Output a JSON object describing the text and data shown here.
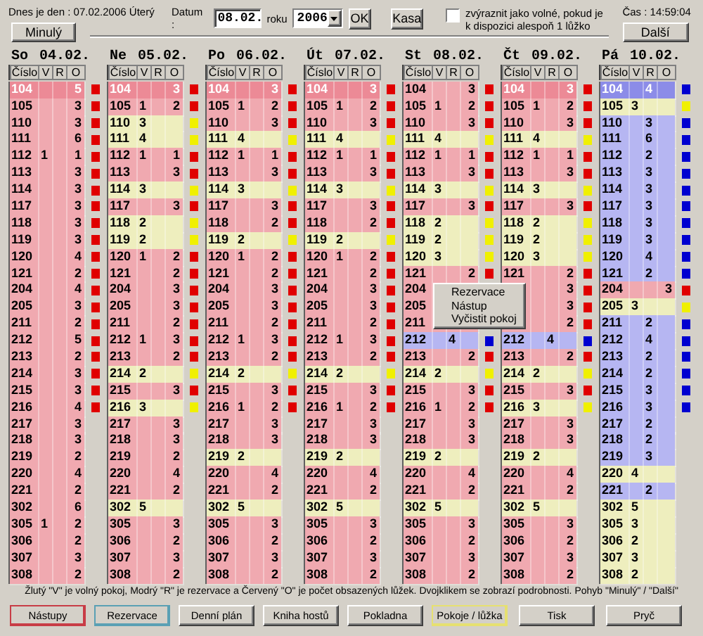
{
  "header": {
    "today": "Dnes je den : 07.02.2006  Úterý",
    "date_label": "Datum :",
    "date_value": "08.02.",
    "year_label": "roku",
    "year_value": "2006",
    "ok_button": "OK",
    "cash_button": "Kasa",
    "highlight_checkbox": {
      "label": "zvýraznit jako volné, pokud je k dispozici alespoň 1 lůžko",
      "checked": false
    },
    "time": "Čas : 14:59:04",
    "prev_button": "Minulý",
    "next_button": "Další"
  },
  "columns": [
    {
      "day": "So",
      "date": "04.02.",
      "headers": [
        "Číslo",
        "V",
        "R",
        "O"
      ],
      "rows": [
        {
          "room": "104",
          "o": "5",
          "kind": "occupied",
          "selected": true,
          "marker": true
        },
        {
          "room": "105",
          "o": "3",
          "kind": "occupied",
          "selected": false,
          "marker": true
        },
        {
          "room": "110",
          "o": "3",
          "kind": "occupied",
          "selected": false,
          "marker": true
        },
        {
          "room": "111",
          "o": "6",
          "kind": "occupied",
          "selected": false,
          "marker": true
        },
        {
          "room": "112",
          "v": "1",
          "o": "1",
          "kind": "occupied",
          "selected": false,
          "marker": true
        },
        {
          "room": "113",
          "o": "3",
          "kind": "occupied",
          "selected": false,
          "marker": true
        },
        {
          "room": "114",
          "o": "3",
          "kind": "occupied",
          "selected": false,
          "marker": true
        },
        {
          "room": "117",
          "o": "3",
          "kind": "occupied",
          "selected": false,
          "marker": true
        },
        {
          "room": "118",
          "o": "3",
          "kind": "occupied",
          "selected": false,
          "marker": true
        },
        {
          "room": "119",
          "o": "3",
          "kind": "occupied",
          "selected": false,
          "marker": true
        },
        {
          "room": "120",
          "o": "4",
          "kind": "occupied",
          "selected": false,
          "marker": true
        },
        {
          "room": "121",
          "o": "2",
          "kind": "occupied",
          "selected": false,
          "marker": true
        },
        {
          "room": "204",
          "o": "4",
          "kind": "occupied",
          "selected": false,
          "marker": true
        },
        {
          "room": "205",
          "o": "3",
          "kind": "occupied",
          "selected": false,
          "marker": true
        },
        {
          "room": "211",
          "o": "2",
          "kind": "occupied",
          "selected": false,
          "marker": true
        },
        {
          "room": "212",
          "o": "5",
          "kind": "occupied",
          "selected": false,
          "marker": true
        },
        {
          "room": "213",
          "o": "2",
          "kind": "occupied",
          "selected": false,
          "marker": true
        },
        {
          "room": "214",
          "o": "3",
          "kind": "occupied",
          "selected": false,
          "marker": true
        },
        {
          "room": "215",
          "o": "3",
          "kind": "occupied",
          "selected": false,
          "marker": true
        },
        {
          "room": "216",
          "o": "4",
          "kind": "occupied",
          "selected": false,
          "marker": true
        },
        {
          "room": "217",
          "o": "3",
          "kind": "occupied",
          "selected": false,
          "marker": false
        },
        {
          "room": "218",
          "o": "3",
          "kind": "occupied",
          "selected": false,
          "marker": false
        },
        {
          "room": "219",
          "o": "2",
          "kind": "occupied",
          "selected": false,
          "marker": false
        },
        {
          "room": "220",
          "o": "4",
          "kind": "occupied",
          "selected": false,
          "marker": false
        },
        {
          "room": "221",
          "o": "2",
          "kind": "occupied",
          "selected": false,
          "marker": false
        },
        {
          "room": "302",
          "o": "6",
          "kind": "occupied",
          "selected": false,
          "marker": false
        },
        {
          "room": "305",
          "v": "1",
          "o": "2",
          "kind": "occupied",
          "selected": false,
          "marker": false
        },
        {
          "room": "306",
          "o": "2",
          "kind": "occupied",
          "selected": false,
          "marker": false
        },
        {
          "room": "307",
          "o": "3",
          "kind": "occupied",
          "selected": false,
          "marker": false
        },
        {
          "room": "308",
          "o": "2",
          "kind": "occupied",
          "selected": false,
          "marker": false
        }
      ]
    },
    {
      "day": "Ne",
      "date": "05.02.",
      "headers": [
        "Číslo",
        "V",
        "R",
        "O"
      ],
      "rows": [
        {
          "room": "104",
          "o": "3",
          "kind": "occupied",
          "selected": true,
          "marker": true
        },
        {
          "room": "105",
          "v": "1",
          "o": "2",
          "kind": "occupied",
          "selected": false,
          "marker": true
        },
        {
          "room": "110",
          "v": "3",
          "kind": "free",
          "selected": false,
          "marker": true
        },
        {
          "room": "111",
          "v": "4",
          "kind": "free",
          "selected": false,
          "marker": true
        },
        {
          "room": "112",
          "v": "1",
          "o": "1",
          "kind": "occupied",
          "selected": false,
          "marker": true
        },
        {
          "room": "113",
          "o": "3",
          "kind": "occupied",
          "selected": false,
          "marker": true
        },
        {
          "room": "114",
          "v": "3",
          "kind": "free",
          "selected": false,
          "marker": true
        },
        {
          "room": "117",
          "o": "3",
          "kind": "occupied",
          "selected": false,
          "marker": true
        },
        {
          "room": "118",
          "v": "2",
          "kind": "free",
          "selected": false,
          "marker": true
        },
        {
          "room": "119",
          "v": "2",
          "kind": "free",
          "selected": false,
          "marker": true
        },
        {
          "room": "120",
          "v": "1",
          "o": "2",
          "kind": "occupied",
          "selected": false,
          "marker": true
        },
        {
          "room": "121",
          "o": "2",
          "kind": "occupied",
          "selected": false,
          "marker": true
        },
        {
          "room": "204",
          "o": "3",
          "kind": "occupied",
          "selected": false,
          "marker": true
        },
        {
          "room": "205",
          "o": "3",
          "kind": "occupied",
          "selected": false,
          "marker": true
        },
        {
          "room": "211",
          "o": "2",
          "kind": "occupied",
          "selected": false,
          "marker": true
        },
        {
          "room": "212",
          "v": "1",
          "o": "3",
          "kind": "occupied",
          "selected": false,
          "marker": true
        },
        {
          "room": "213",
          "o": "2",
          "kind": "occupied",
          "selected": false,
          "marker": true
        },
        {
          "room": "214",
          "v": "2",
          "kind": "free",
          "selected": false,
          "marker": true
        },
        {
          "room": "215",
          "o": "3",
          "kind": "occupied",
          "selected": false,
          "marker": true
        },
        {
          "room": "216",
          "v": "3",
          "kind": "free",
          "selected": false,
          "marker": true
        },
        {
          "room": "217",
          "o": "3",
          "kind": "occupied",
          "selected": false,
          "marker": false
        },
        {
          "room": "218",
          "o": "3",
          "kind": "occupied",
          "selected": false,
          "marker": false
        },
        {
          "room": "219",
          "o": "2",
          "kind": "occupied",
          "selected": false,
          "marker": false
        },
        {
          "room": "220",
          "o": "4",
          "kind": "occupied",
          "selected": false,
          "marker": false
        },
        {
          "room": "221",
          "o": "2",
          "kind": "occupied",
          "selected": false,
          "marker": false
        },
        {
          "room": "302",
          "v": "5",
          "kind": "free",
          "selected": false,
          "marker": false
        },
        {
          "room": "305",
          "o": "3",
          "kind": "occupied",
          "selected": false,
          "marker": false
        },
        {
          "room": "306",
          "o": "2",
          "kind": "occupied",
          "selected": false,
          "marker": false
        },
        {
          "room": "307",
          "o": "3",
          "kind": "occupied",
          "selected": false,
          "marker": false
        },
        {
          "room": "308",
          "o": "2",
          "kind": "occupied",
          "selected": false,
          "marker": false
        }
      ]
    },
    {
      "day": "Po",
      "date": "06.02.",
      "headers": [
        "Číslo",
        "V",
        "R",
        "O"
      ],
      "rows": [
        {
          "room": "104",
          "o": "3",
          "kind": "occupied",
          "selected": true,
          "marker": true
        },
        {
          "room": "105",
          "v": "1",
          "o": "2",
          "kind": "occupied",
          "selected": false,
          "marker": true
        },
        {
          "room": "110",
          "o": "3",
          "kind": "occupied",
          "selected": false,
          "marker": true
        },
        {
          "room": "111",
          "v": "4",
          "kind": "free",
          "selected": false,
          "marker": true
        },
        {
          "room": "112",
          "v": "1",
          "o": "1",
          "kind": "occupied",
          "selected": false,
          "marker": true
        },
        {
          "room": "113",
          "o": "3",
          "kind": "occupied",
          "selected": false,
          "marker": true
        },
        {
          "room": "114",
          "v": "3",
          "kind": "free",
          "selected": false,
          "marker": true
        },
        {
          "room": "117",
          "o": "3",
          "kind": "occupied",
          "selected": false,
          "marker": true
        },
        {
          "room": "118",
          "o": "2",
          "kind": "occupied",
          "selected": false,
          "marker": true
        },
        {
          "room": "119",
          "v": "2",
          "kind": "free",
          "selected": false,
          "marker": true
        },
        {
          "room": "120",
          "v": "1",
          "o": "2",
          "kind": "occupied",
          "selected": false,
          "marker": true
        },
        {
          "room": "121",
          "o": "2",
          "kind": "occupied",
          "selected": false,
          "marker": true
        },
        {
          "room": "204",
          "o": "3",
          "kind": "occupied",
          "selected": false,
          "marker": true
        },
        {
          "room": "205",
          "o": "3",
          "kind": "occupied",
          "selected": false,
          "marker": true
        },
        {
          "room": "211",
          "o": "2",
          "kind": "occupied",
          "selected": false,
          "marker": true
        },
        {
          "room": "212",
          "v": "1",
          "o": "3",
          "kind": "occupied",
          "selected": false,
          "marker": true
        },
        {
          "room": "213",
          "o": "2",
          "kind": "occupied",
          "selected": false,
          "marker": true
        },
        {
          "room": "214",
          "v": "2",
          "kind": "free",
          "selected": false,
          "marker": true
        },
        {
          "room": "215",
          "o": "3",
          "kind": "occupied",
          "selected": false,
          "marker": true
        },
        {
          "room": "216",
          "v": "1",
          "o": "2",
          "kind": "occupied",
          "selected": false,
          "marker": true
        },
        {
          "room": "217",
          "o": "3",
          "kind": "occupied",
          "selected": false,
          "marker": false
        },
        {
          "room": "218",
          "o": "3",
          "kind": "occupied",
          "selected": false,
          "marker": false
        },
        {
          "room": "219",
          "v": "2",
          "kind": "free",
          "selected": false,
          "marker": false
        },
        {
          "room": "220",
          "o": "4",
          "kind": "occupied",
          "selected": false,
          "marker": false
        },
        {
          "room": "221",
          "o": "2",
          "kind": "occupied",
          "selected": false,
          "marker": false
        },
        {
          "room": "302",
          "v": "5",
          "kind": "free",
          "selected": false,
          "marker": false
        },
        {
          "room": "305",
          "o": "3",
          "kind": "occupied",
          "selected": false,
          "marker": false
        },
        {
          "room": "306",
          "o": "2",
          "kind": "occupied",
          "selected": false,
          "marker": false
        },
        {
          "room": "307",
          "o": "3",
          "kind": "occupied",
          "selected": false,
          "marker": false
        },
        {
          "room": "308",
          "o": "2",
          "kind": "occupied",
          "selected": false,
          "marker": false
        }
      ]
    },
    {
      "day": "Út",
      "date": "07.02.",
      "headers": [
        "Číslo",
        "V",
        "R",
        "O"
      ],
      "rows": [
        {
          "room": "104",
          "o": "3",
          "kind": "occupied",
          "selected": true,
          "marker": true
        },
        {
          "room": "105",
          "v": "1",
          "o": "2",
          "kind": "occupied",
          "selected": false,
          "marker": true
        },
        {
          "room": "110",
          "o": "3",
          "kind": "occupied",
          "selected": false,
          "marker": true
        },
        {
          "room": "111",
          "v": "4",
          "kind": "free",
          "selected": false,
          "marker": true
        },
        {
          "room": "112",
          "v": "1",
          "o": "1",
          "kind": "occupied",
          "selected": false,
          "marker": true
        },
        {
          "room": "113",
          "o": "3",
          "kind": "occupied",
          "selected": false,
          "marker": true
        },
        {
          "room": "114",
          "v": "3",
          "kind": "free",
          "selected": false,
          "marker": true
        },
        {
          "room": "117",
          "o": "3",
          "kind": "occupied",
          "selected": false,
          "marker": true
        },
        {
          "room": "118",
          "o": "2",
          "kind": "occupied",
          "selected": false,
          "marker": true
        },
        {
          "room": "119",
          "v": "2",
          "kind": "free",
          "selected": false,
          "marker": true
        },
        {
          "room": "120",
          "v": "1",
          "o": "2",
          "kind": "occupied",
          "selected": false,
          "marker": true
        },
        {
          "room": "121",
          "o": "2",
          "kind": "occupied",
          "selected": false,
          "marker": true
        },
        {
          "room": "204",
          "o": "3",
          "kind": "occupied",
          "selected": false,
          "marker": true
        },
        {
          "room": "205",
          "o": "3",
          "kind": "occupied",
          "selected": false,
          "marker": true
        },
        {
          "room": "211",
          "o": "2",
          "kind": "occupied",
          "selected": false,
          "marker": true
        },
        {
          "room": "212",
          "v": "1",
          "o": "3",
          "kind": "occupied",
          "selected": false,
          "marker": true
        },
        {
          "room": "213",
          "o": "2",
          "kind": "occupied",
          "selected": false,
          "marker": true
        },
        {
          "room": "214",
          "v": "2",
          "kind": "free",
          "selected": false,
          "marker": true
        },
        {
          "room": "215",
          "o": "3",
          "kind": "occupied",
          "selected": false,
          "marker": true
        },
        {
          "room": "216",
          "v": "1",
          "o": "2",
          "kind": "occupied",
          "selected": false,
          "marker": true
        },
        {
          "room": "217",
          "o": "3",
          "kind": "occupied",
          "selected": false,
          "marker": false
        },
        {
          "room": "218",
          "o": "3",
          "kind": "occupied",
          "selected": false,
          "marker": false
        },
        {
          "room": "219",
          "v": "2",
          "kind": "free",
          "selected": false,
          "marker": false
        },
        {
          "room": "220",
          "o": "4",
          "kind": "occupied",
          "selected": false,
          "marker": false
        },
        {
          "room": "221",
          "o": "2",
          "kind": "occupied",
          "selected": false,
          "marker": false
        },
        {
          "room": "302",
          "v": "5",
          "kind": "free",
          "selected": false,
          "marker": false
        },
        {
          "room": "305",
          "o": "3",
          "kind": "occupied",
          "selected": false,
          "marker": false
        },
        {
          "room": "306",
          "o": "2",
          "kind": "occupied",
          "selected": false,
          "marker": false
        },
        {
          "room": "307",
          "o": "3",
          "kind": "occupied",
          "selected": false,
          "marker": false
        },
        {
          "room": "308",
          "o": "2",
          "kind": "occupied",
          "selected": false,
          "marker": false
        }
      ]
    },
    {
      "day": "St",
      "date": "08.02.",
      "headers": [
        "Číslo",
        "V",
        "R",
        "O"
      ],
      "rows": [
        {
          "room": "104",
          "o": "3",
          "kind": "occupied",
          "selected": false,
          "marker": true
        },
        {
          "room": "105",
          "v": "1",
          "o": "2",
          "kind": "occupied",
          "selected": false,
          "marker": true
        },
        {
          "room": "110",
          "o": "3",
          "kind": "occupied",
          "selected": false,
          "marker": true
        },
        {
          "room": "111",
          "v": "4",
          "kind": "free",
          "selected": false,
          "marker": true
        },
        {
          "room": "112",
          "v": "1",
          "o": "1",
          "kind": "occupied",
          "selected": false,
          "marker": true
        },
        {
          "room": "113",
          "o": "3",
          "kind": "occupied",
          "selected": false,
          "marker": true
        },
        {
          "room": "114",
          "v": "3",
          "kind": "free",
          "selected": false,
          "marker": true
        },
        {
          "room": "117",
          "o": "3",
          "kind": "occupied",
          "selected": false,
          "marker": true
        },
        {
          "room": "118",
          "v": "2",
          "kind": "free",
          "selected": false,
          "marker": true
        },
        {
          "room": "119",
          "v": "2",
          "kind": "free",
          "selected": false,
          "marker": true
        },
        {
          "room": "120",
          "v": "3",
          "kind": "free",
          "selected": false,
          "marker": true
        },
        {
          "room": "121",
          "o": "2",
          "kind": "occupied",
          "selected": false,
          "marker": true
        },
        {
          "room": "204",
          "kind": "occupied",
          "selected": false,
          "marker": false
        },
        {
          "room": "205",
          "kind": "occupied",
          "selected": false,
          "marker": false
        },
        {
          "room": "211",
          "kind": "occupied",
          "selected": false,
          "marker": false
        },
        {
          "room": "212",
          "r": "4",
          "kind": "reserved",
          "selected": false,
          "marker": true
        },
        {
          "room": "213",
          "o": "2",
          "kind": "occupied",
          "selected": false,
          "marker": true
        },
        {
          "room": "214",
          "v": "2",
          "kind": "free",
          "selected": false,
          "marker": true
        },
        {
          "room": "215",
          "o": "3",
          "kind": "occupied",
          "selected": false,
          "marker": true
        },
        {
          "room": "216",
          "v": "1",
          "o": "2",
          "kind": "occupied",
          "selected": false,
          "marker": true
        },
        {
          "room": "217",
          "o": "3",
          "kind": "occupied",
          "selected": false,
          "marker": false
        },
        {
          "room": "218",
          "o": "3",
          "kind": "occupied",
          "selected": false,
          "marker": false
        },
        {
          "room": "219",
          "v": "2",
          "kind": "free",
          "selected": false,
          "marker": false
        },
        {
          "room": "220",
          "o": "4",
          "kind": "occupied",
          "selected": false,
          "marker": false
        },
        {
          "room": "221",
          "o": "2",
          "kind": "occupied",
          "selected": false,
          "marker": false
        },
        {
          "room": "302",
          "v": "5",
          "kind": "free",
          "selected": false,
          "marker": false
        },
        {
          "room": "305",
          "o": "3",
          "kind": "occupied",
          "selected": false,
          "marker": false
        },
        {
          "room": "306",
          "o": "2",
          "kind": "occupied",
          "selected": false,
          "marker": false
        },
        {
          "room": "307",
          "o": "3",
          "kind": "occupied",
          "selected": false,
          "marker": false
        },
        {
          "room": "308",
          "o": "2",
          "kind": "occupied",
          "selected": false,
          "marker": false
        }
      ]
    },
    {
      "day": "Čt",
      "date": "09.02.",
      "headers": [
        "Číslo",
        "V",
        "R",
        "O"
      ],
      "rows": [
        {
          "room": "104",
          "o": "3",
          "kind": "occupied",
          "selected": true,
          "marker": true
        },
        {
          "room": "105",
          "v": "1",
          "o": "2",
          "kind": "occupied",
          "selected": false,
          "marker": true
        },
        {
          "room": "110",
          "o": "3",
          "kind": "occupied",
          "selected": false,
          "marker": true
        },
        {
          "room": "111",
          "v": "4",
          "kind": "free",
          "selected": false,
          "marker": true
        },
        {
          "room": "112",
          "v": "1",
          "o": "1",
          "kind": "occupied",
          "selected": false,
          "marker": true
        },
        {
          "room": "113",
          "o": "3",
          "kind": "occupied",
          "selected": false,
          "marker": true
        },
        {
          "room": "114",
          "v": "3",
          "kind": "free",
          "selected": false,
          "marker": true
        },
        {
          "room": "117",
          "o": "3",
          "kind": "occupied",
          "selected": false,
          "marker": true
        },
        {
          "room": "118",
          "v": "2",
          "kind": "free",
          "selected": false,
          "marker": true
        },
        {
          "room": "119",
          "v": "2",
          "kind": "free",
          "selected": false,
          "marker": true
        },
        {
          "room": "120",
          "v": "3",
          "kind": "free",
          "selected": false,
          "marker": true
        },
        {
          "room": "121",
          "o": "2",
          "kind": "occupied",
          "selected": false,
          "marker": true
        },
        {
          "o": "3",
          "kind": "occupied",
          "selected": false,
          "marker": true
        },
        {
          "o": "3",
          "kind": "occupied",
          "selected": false,
          "marker": true
        },
        {
          "o": "2",
          "kind": "occupied",
          "selected": false,
          "marker": true
        },
        {
          "room": "212",
          "r": "4",
          "kind": "reserved",
          "selected": false,
          "marker": true
        },
        {
          "room": "213",
          "o": "2",
          "kind": "occupied",
          "selected": false,
          "marker": true
        },
        {
          "room": "214",
          "v": "2",
          "kind": "free",
          "selected": false,
          "marker": true
        },
        {
          "room": "215",
          "o": "3",
          "kind": "occupied",
          "selected": false,
          "marker": true
        },
        {
          "room": "216",
          "v": "3",
          "kind": "free",
          "selected": false,
          "marker": true
        },
        {
          "room": "217",
          "o": "3",
          "kind": "occupied",
          "selected": false,
          "marker": false
        },
        {
          "room": "218",
          "o": "3",
          "kind": "occupied",
          "selected": false,
          "marker": false
        },
        {
          "room": "219",
          "v": "2",
          "kind": "free",
          "selected": false,
          "marker": false
        },
        {
          "room": "220",
          "o": "4",
          "kind": "occupied",
          "selected": false,
          "marker": false
        },
        {
          "room": "221",
          "o": "2",
          "kind": "occupied",
          "selected": false,
          "marker": false
        },
        {
          "room": "302",
          "v": "5",
          "kind": "free",
          "selected": false,
          "marker": false
        },
        {
          "room": "305",
          "o": "3",
          "kind": "occupied",
          "selected": false,
          "marker": false
        },
        {
          "room": "306",
          "o": "2",
          "kind": "occupied",
          "selected": false,
          "marker": false
        },
        {
          "room": "307",
          "o": "3",
          "kind": "occupied",
          "selected": false,
          "marker": false
        },
        {
          "room": "308",
          "o": "2",
          "kind": "occupied",
          "selected": false,
          "marker": false
        }
      ]
    },
    {
      "day": "Pá",
      "date": "10.02.",
      "headers": [
        "Číslo",
        "V",
        "R",
        "O"
      ],
      "rows": [
        {
          "room": "104",
          "r": "4",
          "kind": "reserved",
          "selected": true,
          "marker": true
        },
        {
          "room": "105",
          "v": "3",
          "kind": "free",
          "selected": false,
          "marker": true
        },
        {
          "room": "110",
          "r": "3",
          "kind": "reserved",
          "selected": false,
          "marker": true
        },
        {
          "room": "111",
          "r": "6",
          "kind": "reserved",
          "selected": false,
          "marker": true
        },
        {
          "room": "112",
          "r": "2",
          "kind": "reserved",
          "selected": false,
          "marker": true
        },
        {
          "room": "113",
          "r": "3",
          "kind": "reserved",
          "selected": false,
          "marker": true
        },
        {
          "room": "114",
          "r": "3",
          "kind": "reserved",
          "selected": false,
          "marker": true
        },
        {
          "room": "117",
          "r": "3",
          "kind": "reserved",
          "selected": false,
          "marker": true
        },
        {
          "room": "118",
          "r": "3",
          "kind": "reserved",
          "selected": false,
          "marker": true
        },
        {
          "room": "119",
          "r": "3",
          "kind": "reserved",
          "selected": false,
          "marker": true
        },
        {
          "room": "120",
          "r": "4",
          "kind": "reserved",
          "selected": false,
          "marker": true
        },
        {
          "room": "121",
          "r": "2",
          "kind": "reserved",
          "selected": false,
          "marker": true
        },
        {
          "room": "204",
          "o": "3",
          "kind": "occupied",
          "selected": false,
          "marker": true
        },
        {
          "room": "205",
          "v": "3",
          "kind": "free",
          "selected": false,
          "marker": true
        },
        {
          "room": "211",
          "r": "2",
          "kind": "reserved",
          "selected": false,
          "marker": true
        },
        {
          "room": "212",
          "r": "4",
          "kind": "reserved",
          "selected": false,
          "marker": true
        },
        {
          "room": "213",
          "r": "2",
          "kind": "reserved",
          "selected": false,
          "marker": true
        },
        {
          "room": "214",
          "r": "2",
          "kind": "reserved",
          "selected": false,
          "marker": true
        },
        {
          "room": "215",
          "r": "3",
          "kind": "reserved",
          "selected": false,
          "marker": true
        },
        {
          "room": "216",
          "r": "3",
          "kind": "reserved",
          "selected": false,
          "marker": true
        },
        {
          "room": "217",
          "r": "2",
          "kind": "reserved",
          "selected": false,
          "marker": false
        },
        {
          "room": "218",
          "r": "2",
          "kind": "reserved",
          "selected": false,
          "marker": false
        },
        {
          "room": "219",
          "r": "3",
          "kind": "reserved",
          "selected": false,
          "marker": false
        },
        {
          "room": "220",
          "v": "4",
          "kind": "free",
          "selected": false,
          "marker": false
        },
        {
          "room": "221",
          "r": "2",
          "kind": "reserved",
          "selected": false,
          "marker": false
        },
        {
          "room": "302",
          "v": "5",
          "kind": "free",
          "selected": false,
          "marker": false
        },
        {
          "room": "305",
          "v": "3",
          "kind": "free",
          "selected": false,
          "marker": false
        },
        {
          "room": "306",
          "v": "2",
          "kind": "free",
          "selected": false,
          "marker": false
        },
        {
          "room": "307",
          "v": "3",
          "kind": "free",
          "selected": false,
          "marker": false
        },
        {
          "room": "308",
          "v": "2",
          "kind": "free",
          "selected": false,
          "marker": false
        }
      ]
    }
  ],
  "context_menu": [
    "Rezervace",
    "Nástup",
    "Vyčistit pokoj"
  ],
  "legend": "Žlutý \"V\" je volný pokoj, Modrý \"R\" je rezervace a Červený \"O\" je počet obsazených lůžek. Dvojklikem se zobrazí podrobnosti. Pohyb \"Minulý\" / \"Další\"",
  "buttons": [
    {
      "label": "Nástupy",
      "color": "#c83c46"
    },
    {
      "label": "Rezervace",
      "color": "#5aa0b4"
    },
    {
      "label": "Denní plán"
    },
    {
      "label": "Kniha hostů"
    },
    {
      "label": "Pokladna"
    },
    {
      "label": "Pokoje / lůžka",
      "color": "#e6e070"
    },
    {
      "label": "Tisk"
    },
    {
      "label": "Pryč"
    }
  ]
}
